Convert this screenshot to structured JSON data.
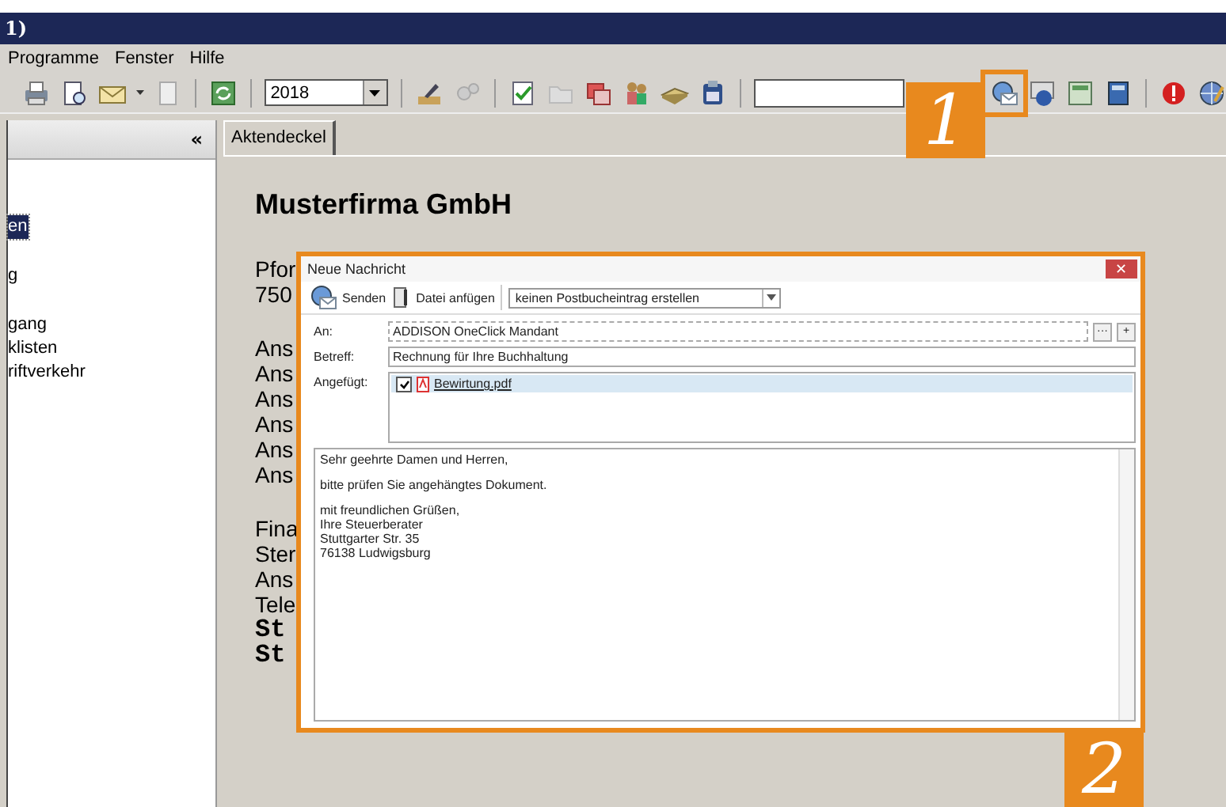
{
  "window": {
    "title": "1)"
  },
  "menu": [
    "Programme",
    "Fenster",
    "Hilfe"
  ],
  "toolbar": {
    "year": "2018",
    "mail_highlighted": true
  },
  "sidebar": {
    "collapse": "«",
    "items": [
      {
        "label": "en",
        "selected": true
      },
      {
        "label": "g",
        "selected": false
      },
      {
        "label": "gang",
        "selected": false
      },
      {
        "label": "klisten",
        "selected": false
      },
      {
        "label": "riftverkehr",
        "selected": false
      }
    ]
  },
  "tabs": [
    {
      "label": "Aktendeckel",
      "selected": true
    }
  ],
  "document": {
    "company": "Musterfirma GmbH",
    "groups": [
      [
        {
          "text": "Pfor",
          "kind": "normal"
        },
        {
          "text": "750",
          "kind": "normal"
        }
      ],
      [
        {
          "text": "Ans",
          "kind": "normal"
        },
        {
          "text": "Ans",
          "kind": "normal"
        },
        {
          "text": "Ans",
          "kind": "normal"
        },
        {
          "text": "Ans",
          "kind": "normal"
        },
        {
          "text": "Ans",
          "kind": "normal"
        },
        {
          "text": "Ans",
          "kind": "normal"
        }
      ],
      [
        {
          "text": "Fina",
          "kind": "normal"
        },
        {
          "text": "Ster",
          "kind": "normal"
        },
        {
          "text": "Ans",
          "kind": "normal"
        },
        {
          "text": "Tele",
          "kind": "normal"
        },
        {
          "text": "St",
          "kind": "bold"
        },
        {
          "text": "St",
          "kind": "bold"
        }
      ]
    ]
  },
  "dialog": {
    "title": "Neue Nachricht",
    "close": "✕",
    "send": "Senden",
    "attach": "Datei anfügen",
    "booking": "keinen Postbucheintrag erstellen",
    "to": {
      "label": "An:",
      "value": "ADDISON OneClick Mandant",
      "browse": "···",
      "add": "+"
    },
    "subject": {
      "label": "Betreff:",
      "value": "Rechnung für Ihre Buchhaltung"
    },
    "attachments": {
      "label": "Angefügt:",
      "items": [
        {
          "name": "Bewirtung.pdf",
          "checked": true,
          "selected": true
        }
      ]
    },
    "body": [
      [
        "Sehr geehrte Damen und Herren,"
      ],
      [
        "bitte prüfen Sie angehängtes Dokument."
      ],
      [
        "mit freundlichen Grüßen,",
        "Ihre Steuerberater",
        "Stuttgarter Str. 35",
        "76138 Ludwigsburg"
      ]
    ]
  },
  "callouts": [
    "1",
    "2"
  ]
}
